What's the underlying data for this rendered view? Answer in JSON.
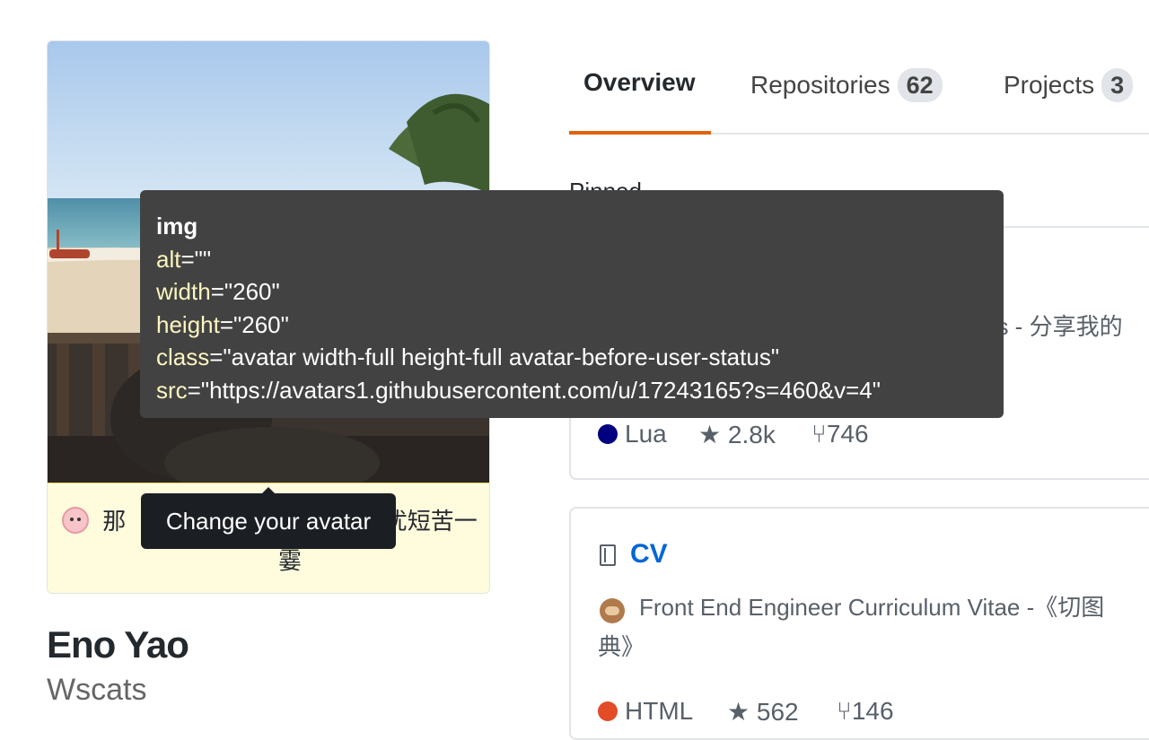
{
  "avatar": {
    "status_text": "那                            你说忘 忧短苦一霎",
    "tooltip": "Change your avatar"
  },
  "profile": {
    "name": "Eno Yao",
    "login": "Wscats"
  },
  "tabs": [
    {
      "label": "Overview",
      "selected": true
    },
    {
      "label": "Repositories",
      "count": "62",
      "selected": false
    },
    {
      "label": "Projects",
      "count": "3",
      "selected": false
    }
  ],
  "pinned": {
    "heading": "Pinned",
    "repos": [
      {
        "description": "es - 分享我的",
        "language": "Lua",
        "language_color": "#000080",
        "stars": "2.8k",
        "forks": "746"
      },
      {
        "name": "CV",
        "description_line1": "Front End Engineer Curriculum Vitae -《切图",
        "description_line2": "典》",
        "language": "HTML",
        "language_color": "#e34c26",
        "stars": "562",
        "forks": "146"
      }
    ]
  },
  "inspect_tooltip": {
    "tag": "img",
    "attributes": [
      {
        "name": "alt",
        "value": "=\"\""
      },
      {
        "name": "width",
        "value": "=\"260\""
      },
      {
        "name": "height",
        "value": "=\"260\""
      },
      {
        "name": "class",
        "value": "=\"avatar width-full height-full avatar-before-user-status\""
      },
      {
        "name": "src",
        "value": "=\"https://avatars1.githubusercontent.com/u/17243165?s=460&v=4\""
      }
    ]
  },
  "colors": {
    "accent_tab": "#e36209",
    "link": "#0366d6",
    "status_bg": "#fffbdd",
    "tooltip_bg": "#424242"
  }
}
